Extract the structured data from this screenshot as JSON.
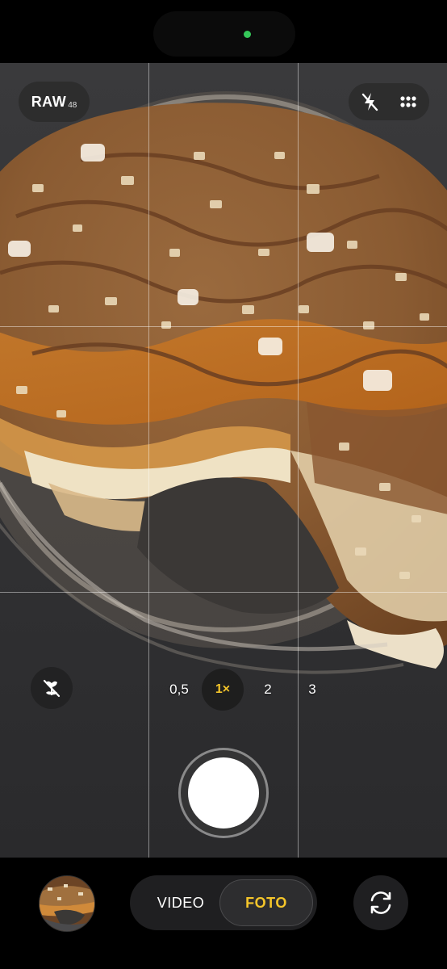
{
  "status": {
    "privacy_indicator_color": "#35c759"
  },
  "top_controls": {
    "raw_label": "RAW",
    "raw_sub_label": "48",
    "flash_icon": "flash-off-icon",
    "more_icon": "grid-dots-icon"
  },
  "macro": {
    "icon": "macro-flower-off-icon"
  },
  "zoom": {
    "options": [
      "0,5",
      "1×",
      "2",
      "3"
    ],
    "selected": "1×",
    "accent_color": "#f4c52a"
  },
  "modes": {
    "video_label": "VIDEO",
    "photo_label": "FOTO",
    "selected": "FOTO"
  },
  "bottom": {
    "thumbnail_icon": "last-photo-thumbnail",
    "flip_icon": "camera-flip-icon"
  }
}
